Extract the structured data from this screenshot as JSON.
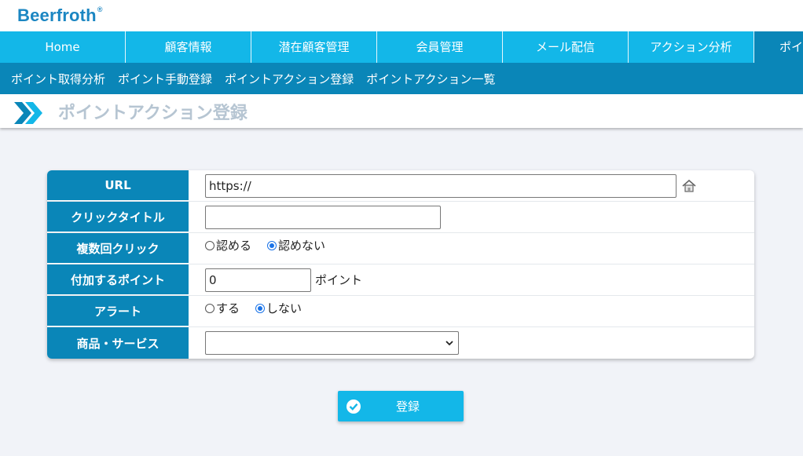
{
  "brand": {
    "name": "Beerfroth",
    "mark": "®",
    "color": "#1b86c2"
  },
  "nav": {
    "items": [
      {
        "label": "Home"
      },
      {
        "label": "顧客情報"
      },
      {
        "label": "潜在顧客管理"
      },
      {
        "label": "会員管理"
      },
      {
        "label": "メール配信"
      },
      {
        "label": "アクション分析"
      },
      {
        "label": "ポイ"
      }
    ],
    "active_index": 6
  },
  "subnav": {
    "items": [
      {
        "label": "ポイント取得分析"
      },
      {
        "label": "ポイント手動登録"
      },
      {
        "label": "ポイントアクション登録"
      },
      {
        "label": "ポイントアクション一覧"
      }
    ]
  },
  "page": {
    "title": "ポイントアクション登録"
  },
  "form": {
    "url": {
      "label": "URL",
      "value": "https://",
      "icon": "home-icon"
    },
    "click_title": {
      "label": "クリックタイトル",
      "value": ""
    },
    "multi_click": {
      "label": "複数回クリック",
      "options": [
        {
          "label": "認める",
          "checked": false
        },
        {
          "label": "認めない",
          "checked": true
        }
      ]
    },
    "points": {
      "label": "付加するポイント",
      "value": "0",
      "unit": "ポイント"
    },
    "alert": {
      "label": "アラート",
      "options": [
        {
          "label": "する",
          "checked": false
        },
        {
          "label": "しない",
          "checked": true
        }
      ]
    },
    "product": {
      "label": "商品・サービス",
      "value": ""
    }
  },
  "submit": {
    "label": "登録",
    "icon": "check-circle-icon"
  },
  "colors": {
    "nav": "#13b7e8",
    "nav_active": "#0a86b8",
    "label_bg": "#0a86b8",
    "title_text": "#b6c5d2"
  }
}
